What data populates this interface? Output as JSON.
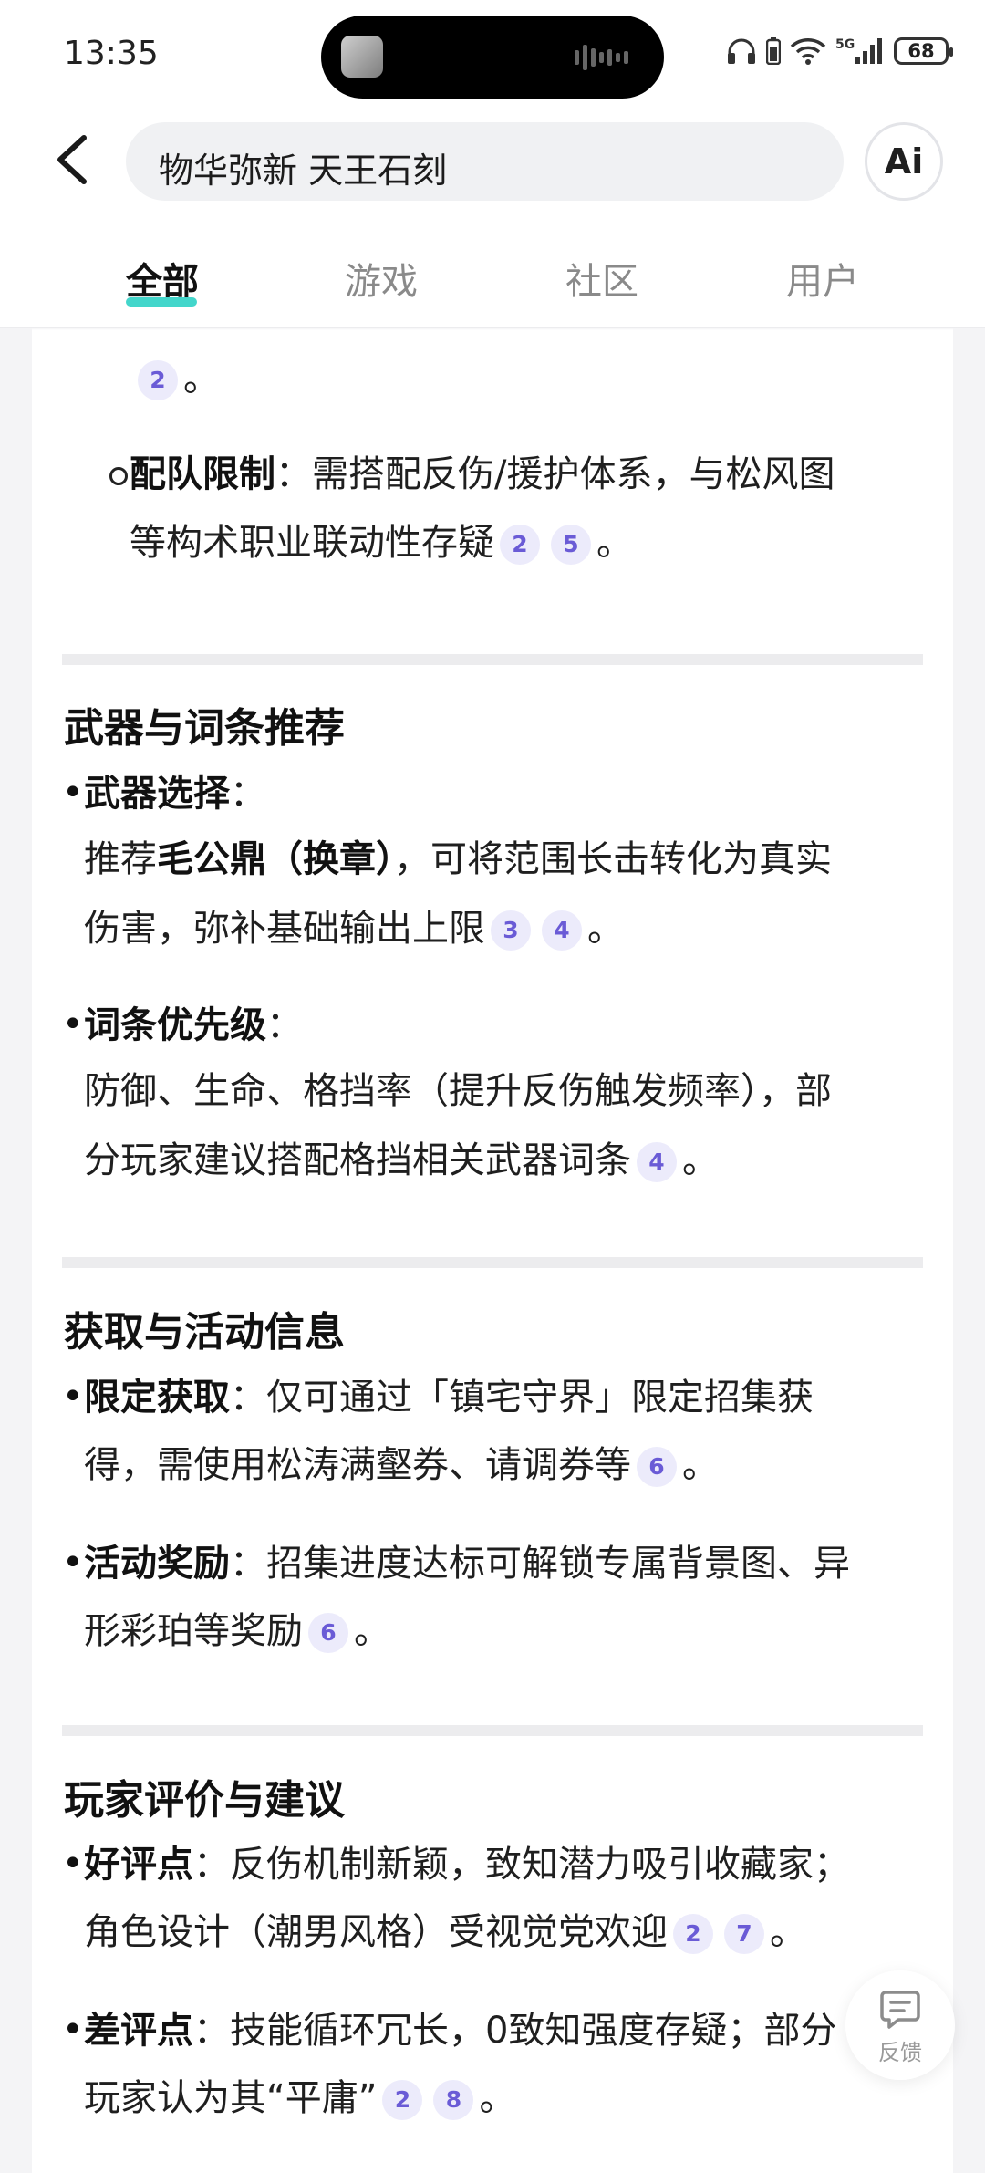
{
  "status_bar": {
    "time": "13:35",
    "battery": "68"
  },
  "search": {
    "query": "物华弥新 天王石刻",
    "ai_label": "Ai"
  },
  "tabs": [
    {
      "label": "全部"
    },
    {
      "label": "游戏"
    },
    {
      "label": "社区"
    },
    {
      "label": "用户"
    }
  ],
  "content": {
    "intro": {
      "cite": "2",
      "end": "。"
    },
    "team_limit": {
      "label": "配队限制",
      "text1": "：需搭配反伤/援护体系，与松风图",
      "text2": "等构术职业联动性存疑",
      "cites": [
        "2",
        "5"
      ],
      "end": "。"
    },
    "weapons": {
      "title": "武器与词条推荐",
      "choice_label": "武器选择",
      "choice_colon": "：",
      "choice_pre": "推荐",
      "choice_bold": "毛公鼎（换章）",
      "choice_post": "，可将范围长击转化为真实",
      "choice_line2": "伤害，弥补基础输出上限",
      "choice_cites": [
        "3",
        "4"
      ],
      "choice_end": "。",
      "stat_label": "词条优先级",
      "stat_colon": "：",
      "stat_line1": "防御、生命、格挡率（提升反伤触发频率），部",
      "stat_line2": "分玩家建议搭配格挡相关武器词条",
      "stat_cite": "4",
      "stat_end": "。"
    },
    "acquire": {
      "title": "获取与活动信息",
      "limit_label": "限定获取",
      "limit_text1": "：仅可通过「镇宅守界」限定招集获",
      "limit_text2": "得，需使用松涛满壑券、请调券等",
      "limit_cite": "6",
      "limit_end": "。",
      "reward_label": "活动奖励",
      "reward_text1": "：招集进度达标可解锁专属背景图、异",
      "reward_text2": "形彩珀等奖励",
      "reward_cite": "6",
      "reward_end": "。"
    },
    "reviews": {
      "title": "玩家评价与建议",
      "good_label": "好评点",
      "good_text1": "：反伤机制新颖，致知潜力吸引收藏家；",
      "good_text2": "角色设计（潮男风格）受视觉党欢迎",
      "good_cites": [
        "2",
        "7"
      ],
      "good_end": "。",
      "bad_label": "差评点",
      "bad_text1": "：技能循环冗长，0致知强度存疑；部分",
      "bad_text2": "玩家认为其“平庸”",
      "bad_cites": [
        "2",
        "8"
      ],
      "bad_end": "。"
    }
  },
  "feedback": {
    "label": "反馈"
  },
  "colors": {
    "accent_tab": "#2fd2c5",
    "cite_bg": "#ecebfb",
    "cite_text": "#6a5bd6"
  }
}
